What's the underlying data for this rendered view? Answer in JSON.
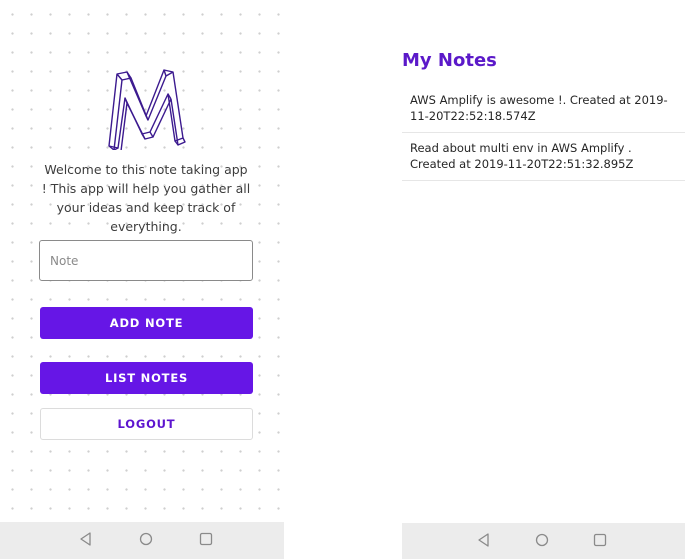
{
  "home": {
    "welcome_text": "Welcome to this note taking app ! This app will help you gather all your ideas and keep track of everything.",
    "note_input": {
      "value": "",
      "placeholder": "Note"
    },
    "add_note_label": "ADD NOTE",
    "list_notes_label": "LIST NOTES",
    "logout_label": "LOGOUT"
  },
  "notes_screen": {
    "title": "My Notes",
    "notes": [
      {
        "text": "AWS Amplify is awesome !. Created at 2019-11-20T22:52:18.574Z"
      },
      {
        "text": "Read about multi env in AWS Amplify . Created at 2019-11-20T22:51:32.895Z"
      }
    ]
  },
  "navigation_bar": {
    "icons": [
      "back-icon",
      "home-icon",
      "recents-icon"
    ]
  },
  "colors": {
    "accent": "#6616e6",
    "title": "#5b19c9",
    "logout_text": "#5d14cf",
    "navbar": "#ececec",
    "logo_stroke": "#3c1a8f"
  }
}
